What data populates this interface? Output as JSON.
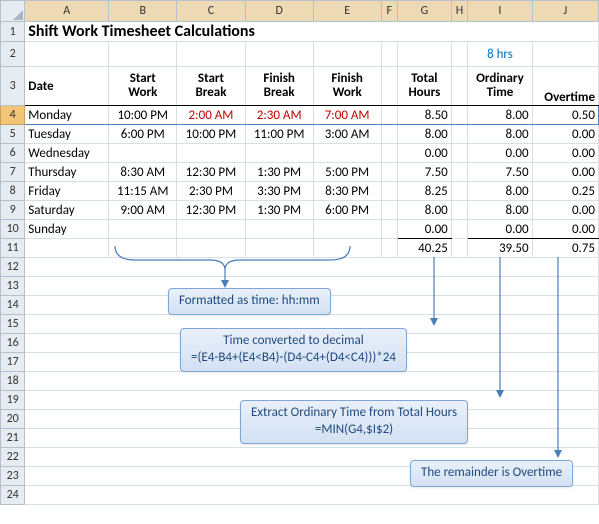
{
  "title": "Shift Work Timesheet Calculations",
  "top_note": "8 hrs",
  "headers": {
    "date": "Date",
    "start_work1": "Start",
    "start_work2": "Work",
    "start_break1": "Start",
    "start_break2": "Break",
    "finish_break1": "Finish",
    "finish_break2": "Break",
    "finish_work1": "Finish",
    "finish_work2": "Work",
    "total_hours1": "Total",
    "total_hours2": "Hours",
    "ordinary1": "Ordinary",
    "ordinary2": "Time",
    "overtime": "Overtime"
  },
  "cols": [
    "A",
    "B",
    "C",
    "D",
    "E",
    "F",
    "G",
    "H",
    "I",
    "J"
  ],
  "rows": [
    {
      "day": "Monday",
      "b": "10:00 PM",
      "c": "2:00 AM",
      "d": "2:30 AM",
      "e": "7:00 AM",
      "g": "8.50",
      "i": "8.00",
      "j": "0.50",
      "red": true
    },
    {
      "day": "Tuesday",
      "b": "6:00 PM",
      "c": "10:00 PM",
      "d": "11:00 PM",
      "e": "3:00 AM",
      "g": "8.00",
      "i": "8.00",
      "j": "0.00"
    },
    {
      "day": "Wednesday",
      "b": "",
      "c": "",
      "d": "",
      "e": "",
      "g": "0.00",
      "i": "0.00",
      "j": "0.00"
    },
    {
      "day": "Thursday",
      "b": "8:30 AM",
      "c": "12:30 PM",
      "d": "1:30 PM",
      "e": "5:00 PM",
      "g": "7.50",
      "i": "7.50",
      "j": "0.00"
    },
    {
      "day": "Friday",
      "b": "11:15 AM",
      "c": "2:30 PM",
      "d": "3:30 PM",
      "e": "8:30 PM",
      "g": "8.25",
      "i": "8.00",
      "j": "0.25"
    },
    {
      "day": "Saturday",
      "b": "9:00 AM",
      "c": "12:30 PM",
      "d": "1:30 PM",
      "e": "6:00 PM",
      "g": "8.00",
      "i": "8.00",
      "j": "0.00"
    },
    {
      "day": "Sunday",
      "b": "",
      "c": "",
      "d": "",
      "e": "",
      "g": "0.00",
      "i": "0.00",
      "j": "0.00"
    }
  ],
  "totals": {
    "g": "40.25",
    "i": "39.50",
    "j": "0.75"
  },
  "callouts": {
    "a": "Formatted as time: hh:mm",
    "b_line1": "Time converted to decimal",
    "b_line2": "=(E4-B4+(E4<B4)-(D4-C4+(D4<C4)))*24",
    "c_line1": "Extract Ordinary Time from Total Hours",
    "c_line2": "=MIN(G4,$I$2)",
    "d": "The remainder is Overtime"
  },
  "chart_data": {
    "type": "table",
    "title": "Shift Work Timesheet Calculations",
    "ordinary_time_limit_hrs": 8,
    "columns": [
      "Date",
      "Start Work",
      "Start Break",
      "Finish Break",
      "Finish Work",
      "Total Hours",
      "Ordinary Time",
      "Overtime"
    ],
    "rows": [
      [
        "Monday",
        "10:00 PM",
        "2:00 AM",
        "2:30 AM",
        "7:00 AM",
        8.5,
        8.0,
        0.5
      ],
      [
        "Tuesday",
        "6:00 PM",
        "10:00 PM",
        "11:00 PM",
        "3:00 AM",
        8.0,
        8.0,
        0.0
      ],
      [
        "Wednesday",
        "",
        "",
        "",
        "",
        0.0,
        0.0,
        0.0
      ],
      [
        "Thursday",
        "8:30 AM",
        "12:30 PM",
        "1:30 PM",
        "5:00 PM",
        7.5,
        7.5,
        0.0
      ],
      [
        "Friday",
        "11:15 AM",
        "2:30 PM",
        "3:30 PM",
        "8:30 PM",
        8.25,
        8.0,
        0.25
      ],
      [
        "Saturday",
        "9:00 AM",
        "12:30 PM",
        "1:30 PM",
        "6:00 PM",
        8.0,
        8.0,
        0.0
      ],
      [
        "Sunday",
        "",
        "",
        "",
        "",
        0.0,
        0.0,
        0.0
      ]
    ],
    "totals": {
      "Total Hours": 40.25,
      "Ordinary Time": 39.5,
      "Overtime": 0.75
    },
    "formulas": {
      "Total Hours": "=(E4-B4+(E4<B4)-(D4-C4+(D4<C4)))*24",
      "Ordinary Time": "=MIN(G4,$I$2)"
    }
  }
}
